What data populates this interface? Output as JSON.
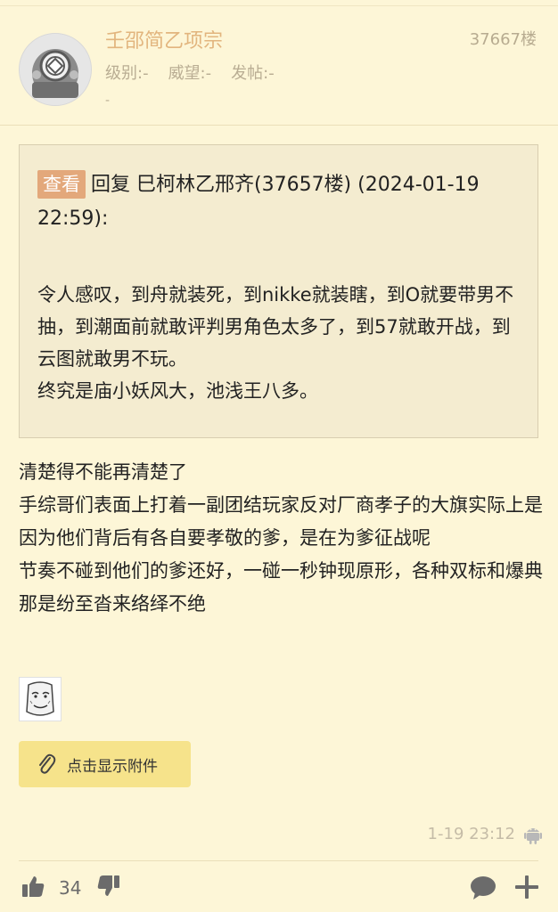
{
  "post": {
    "username": "壬邵简乙项宗",
    "floor": "37667楼",
    "meta": {
      "level": "级别:-",
      "prestige": "威望:-",
      "posts": "发帖:-",
      "extra": "-"
    }
  },
  "quote": {
    "view_label": "查看",
    "header": "回复 巳柯林乙邢齐(37657楼) (2024-01-19 22:59):",
    "lines": [
      "令人感叹，到舟就装死，到nikke就装瞎，到O就要带男不抽，到潮面前就敢评判男角色太多了，到57就敢开战，到云图就敢男不玩。",
      "终究是庙小妖风大，池浅王八多。"
    ]
  },
  "body": {
    "lines": [
      "清楚得不能再清楚了",
      "手综哥们表面上打着一副团结玩家反对厂商孝子的大旗实际上是因为他们背后有各自要孝敬的爹，是在为爹征战呢",
      "节奏不碰到他们的爹还好，一碰一秒钟现原形，各种双标和爆典那是纷至沓来络绎不绝"
    ]
  },
  "attachment": {
    "label": "点击显示附件"
  },
  "timestamp": "1-19 23:12",
  "footer": {
    "likes": "34"
  },
  "icons": {
    "avatar": "diving-helmet-avatar",
    "sticker": "meme-face-sticker",
    "attach": "paperclip-icon",
    "device": "android-icon",
    "like": "thumbs-up-icon",
    "dislike": "thumbs-down-icon",
    "comment": "comment-icon",
    "add": "plus-icon"
  },
  "colors": {
    "background": "#fdf6d7",
    "username": "#e2b57e",
    "view_button": "#e3a87b",
    "attach_button": "#f6e38b",
    "quote_bg": "#f4ecd0"
  }
}
